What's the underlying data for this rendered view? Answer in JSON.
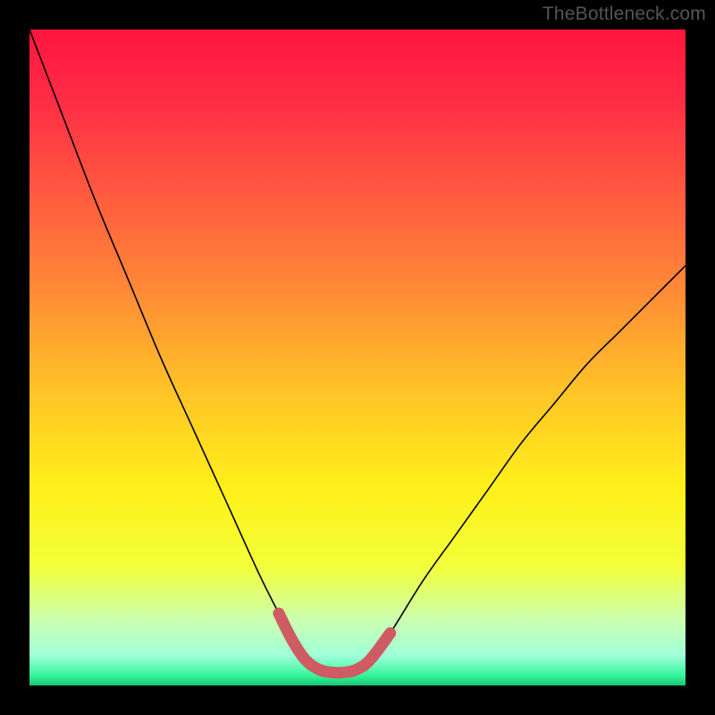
{
  "watermark": "TheBottleneck.com",
  "chart_data": {
    "type": "line",
    "title": "",
    "xlabel": "",
    "ylabel": "",
    "xlim": [
      0,
      100
    ],
    "ylim": [
      0,
      100
    ],
    "grid": false,
    "series": [
      {
        "name": "curve",
        "color": "#000000",
        "x": [
          0,
          5,
          10,
          15,
          20,
          25,
          30,
          35,
          38,
          40,
          42,
          44,
          46,
          48,
          50,
          52,
          55,
          60,
          65,
          70,
          75,
          80,
          85,
          90,
          95,
          100
        ],
        "values": [
          100,
          87,
          74,
          62,
          50,
          39,
          28,
          17,
          11,
          7,
          4,
          2.5,
          2,
          2,
          2.5,
          4,
          8,
          16,
          23,
          30,
          37,
          43,
          49,
          54,
          59,
          64
        ]
      },
      {
        "name": "highlight",
        "color": "#cf5b63",
        "x": [
          38,
          40,
          42,
          44,
          46,
          48,
          50,
          52,
          55
        ],
        "values": [
          11,
          7,
          4,
          2.5,
          2,
          2,
          2.5,
          4,
          8
        ]
      }
    ],
    "background_gradient": {
      "stops": [
        {
          "offset": 0.0,
          "color": "#ff153d"
        },
        {
          "offset": 0.1,
          "color": "#ff2a46"
        },
        {
          "offset": 0.25,
          "color": "#ff5a3f"
        },
        {
          "offset": 0.4,
          "color": "#ff8b36"
        },
        {
          "offset": 0.55,
          "color": "#ffc327"
        },
        {
          "offset": 0.7,
          "color": "#fff01a"
        },
        {
          "offset": 0.82,
          "color": "#f2ff3a"
        },
        {
          "offset": 0.9,
          "color": "#ccffb0"
        },
        {
          "offset": 0.955,
          "color": "#9fffd8"
        },
        {
          "offset": 0.985,
          "color": "#34f59a"
        },
        {
          "offset": 1.0,
          "color": "#18c574"
        }
      ]
    }
  }
}
